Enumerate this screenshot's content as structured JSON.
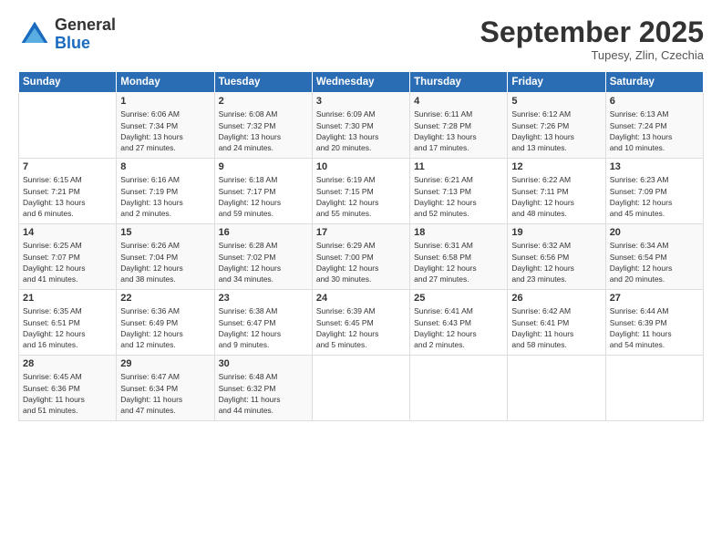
{
  "logo": {
    "general": "General",
    "blue": "Blue"
  },
  "title": "September 2025",
  "location": "Tupesy, Zlin, Czechia",
  "days_of_week": [
    "Sunday",
    "Monday",
    "Tuesday",
    "Wednesday",
    "Thursday",
    "Friday",
    "Saturday"
  ],
  "weeks": [
    [
      {
        "day": "",
        "info": ""
      },
      {
        "day": "1",
        "info": "Sunrise: 6:06 AM\nSunset: 7:34 PM\nDaylight: 13 hours\nand 27 minutes."
      },
      {
        "day": "2",
        "info": "Sunrise: 6:08 AM\nSunset: 7:32 PM\nDaylight: 13 hours\nand 24 minutes."
      },
      {
        "day": "3",
        "info": "Sunrise: 6:09 AM\nSunset: 7:30 PM\nDaylight: 13 hours\nand 20 minutes."
      },
      {
        "day": "4",
        "info": "Sunrise: 6:11 AM\nSunset: 7:28 PM\nDaylight: 13 hours\nand 17 minutes."
      },
      {
        "day": "5",
        "info": "Sunrise: 6:12 AM\nSunset: 7:26 PM\nDaylight: 13 hours\nand 13 minutes."
      },
      {
        "day": "6",
        "info": "Sunrise: 6:13 AM\nSunset: 7:24 PM\nDaylight: 13 hours\nand 10 minutes."
      }
    ],
    [
      {
        "day": "7",
        "info": "Sunrise: 6:15 AM\nSunset: 7:21 PM\nDaylight: 13 hours\nand 6 minutes."
      },
      {
        "day": "8",
        "info": "Sunrise: 6:16 AM\nSunset: 7:19 PM\nDaylight: 13 hours\nand 2 minutes."
      },
      {
        "day": "9",
        "info": "Sunrise: 6:18 AM\nSunset: 7:17 PM\nDaylight: 12 hours\nand 59 minutes."
      },
      {
        "day": "10",
        "info": "Sunrise: 6:19 AM\nSunset: 7:15 PM\nDaylight: 12 hours\nand 55 minutes."
      },
      {
        "day": "11",
        "info": "Sunrise: 6:21 AM\nSunset: 7:13 PM\nDaylight: 12 hours\nand 52 minutes."
      },
      {
        "day": "12",
        "info": "Sunrise: 6:22 AM\nSunset: 7:11 PM\nDaylight: 12 hours\nand 48 minutes."
      },
      {
        "day": "13",
        "info": "Sunrise: 6:23 AM\nSunset: 7:09 PM\nDaylight: 12 hours\nand 45 minutes."
      }
    ],
    [
      {
        "day": "14",
        "info": "Sunrise: 6:25 AM\nSunset: 7:07 PM\nDaylight: 12 hours\nand 41 minutes."
      },
      {
        "day": "15",
        "info": "Sunrise: 6:26 AM\nSunset: 7:04 PM\nDaylight: 12 hours\nand 38 minutes."
      },
      {
        "day": "16",
        "info": "Sunrise: 6:28 AM\nSunset: 7:02 PM\nDaylight: 12 hours\nand 34 minutes."
      },
      {
        "day": "17",
        "info": "Sunrise: 6:29 AM\nSunset: 7:00 PM\nDaylight: 12 hours\nand 30 minutes."
      },
      {
        "day": "18",
        "info": "Sunrise: 6:31 AM\nSunset: 6:58 PM\nDaylight: 12 hours\nand 27 minutes."
      },
      {
        "day": "19",
        "info": "Sunrise: 6:32 AM\nSunset: 6:56 PM\nDaylight: 12 hours\nand 23 minutes."
      },
      {
        "day": "20",
        "info": "Sunrise: 6:34 AM\nSunset: 6:54 PM\nDaylight: 12 hours\nand 20 minutes."
      }
    ],
    [
      {
        "day": "21",
        "info": "Sunrise: 6:35 AM\nSunset: 6:51 PM\nDaylight: 12 hours\nand 16 minutes."
      },
      {
        "day": "22",
        "info": "Sunrise: 6:36 AM\nSunset: 6:49 PM\nDaylight: 12 hours\nand 12 minutes."
      },
      {
        "day": "23",
        "info": "Sunrise: 6:38 AM\nSunset: 6:47 PM\nDaylight: 12 hours\nand 9 minutes."
      },
      {
        "day": "24",
        "info": "Sunrise: 6:39 AM\nSunset: 6:45 PM\nDaylight: 12 hours\nand 5 minutes."
      },
      {
        "day": "25",
        "info": "Sunrise: 6:41 AM\nSunset: 6:43 PM\nDaylight: 12 hours\nand 2 minutes."
      },
      {
        "day": "26",
        "info": "Sunrise: 6:42 AM\nSunset: 6:41 PM\nDaylight: 11 hours\nand 58 minutes."
      },
      {
        "day": "27",
        "info": "Sunrise: 6:44 AM\nSunset: 6:39 PM\nDaylight: 11 hours\nand 54 minutes."
      }
    ],
    [
      {
        "day": "28",
        "info": "Sunrise: 6:45 AM\nSunset: 6:36 PM\nDaylight: 11 hours\nand 51 minutes."
      },
      {
        "day": "29",
        "info": "Sunrise: 6:47 AM\nSunset: 6:34 PM\nDaylight: 11 hours\nand 47 minutes."
      },
      {
        "day": "30",
        "info": "Sunrise: 6:48 AM\nSunset: 6:32 PM\nDaylight: 11 hours\nand 44 minutes."
      },
      {
        "day": "",
        "info": ""
      },
      {
        "day": "",
        "info": ""
      },
      {
        "day": "",
        "info": ""
      },
      {
        "day": "",
        "info": ""
      }
    ]
  ]
}
